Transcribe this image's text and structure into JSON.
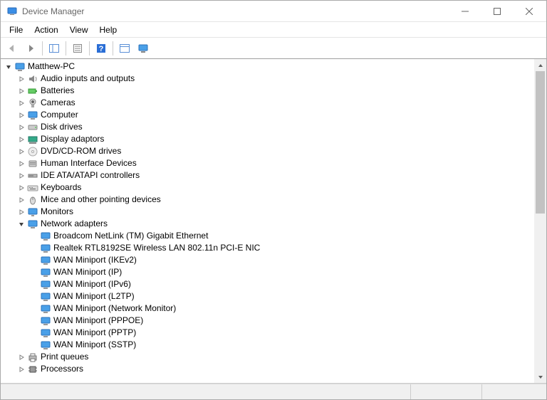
{
  "window": {
    "title": "Device Manager"
  },
  "menu": {
    "file": "File",
    "action": "Action",
    "view": "View",
    "help": "Help"
  },
  "tree": {
    "root": "Matthew-PC",
    "categories": [
      {
        "label": "Audio inputs and outputs",
        "icon": "audio",
        "expanded": false
      },
      {
        "label": "Batteries",
        "icon": "battery",
        "expanded": false
      },
      {
        "label": "Cameras",
        "icon": "camera",
        "expanded": false
      },
      {
        "label": "Computer",
        "icon": "computer",
        "expanded": false
      },
      {
        "label": "Disk drives",
        "icon": "disk",
        "expanded": false
      },
      {
        "label": "Display adaptors",
        "icon": "display",
        "expanded": false
      },
      {
        "label": "DVD/CD-ROM drives",
        "icon": "cdrom",
        "expanded": false
      },
      {
        "label": "Human Interface Devices",
        "icon": "hid",
        "expanded": false
      },
      {
        "label": "IDE ATA/ATAPI controllers",
        "icon": "ide",
        "expanded": false
      },
      {
        "label": "Keyboards",
        "icon": "keyboard",
        "expanded": false
      },
      {
        "label": "Mice and other pointing devices",
        "icon": "mouse",
        "expanded": false
      },
      {
        "label": "Monitors",
        "icon": "monitor",
        "expanded": false
      },
      {
        "label": "Network adapters",
        "icon": "network",
        "expanded": true,
        "children": [
          {
            "label": "Broadcom NetLink (TM) Gigabit Ethernet",
            "icon": "netcard"
          },
          {
            "label": "Realtek RTL8192SE Wireless LAN 802.11n PCI-E NIC",
            "icon": "netcard"
          },
          {
            "label": "WAN Miniport (IKEv2)",
            "icon": "netcard"
          },
          {
            "label": "WAN Miniport (IP)",
            "icon": "netcard"
          },
          {
            "label": "WAN Miniport (IPv6)",
            "icon": "netcard"
          },
          {
            "label": "WAN Miniport (L2TP)",
            "icon": "netcard"
          },
          {
            "label": "WAN Miniport (Network Monitor)",
            "icon": "netcard"
          },
          {
            "label": "WAN Miniport (PPPOE)",
            "icon": "netcard"
          },
          {
            "label": "WAN Miniport (PPTP)",
            "icon": "netcard"
          },
          {
            "label": "WAN Miniport (SSTP)",
            "icon": "netcard"
          }
        ]
      },
      {
        "label": "Print queues",
        "icon": "printer",
        "expanded": false
      },
      {
        "label": "Processors",
        "icon": "cpu",
        "expanded": false
      }
    ]
  }
}
